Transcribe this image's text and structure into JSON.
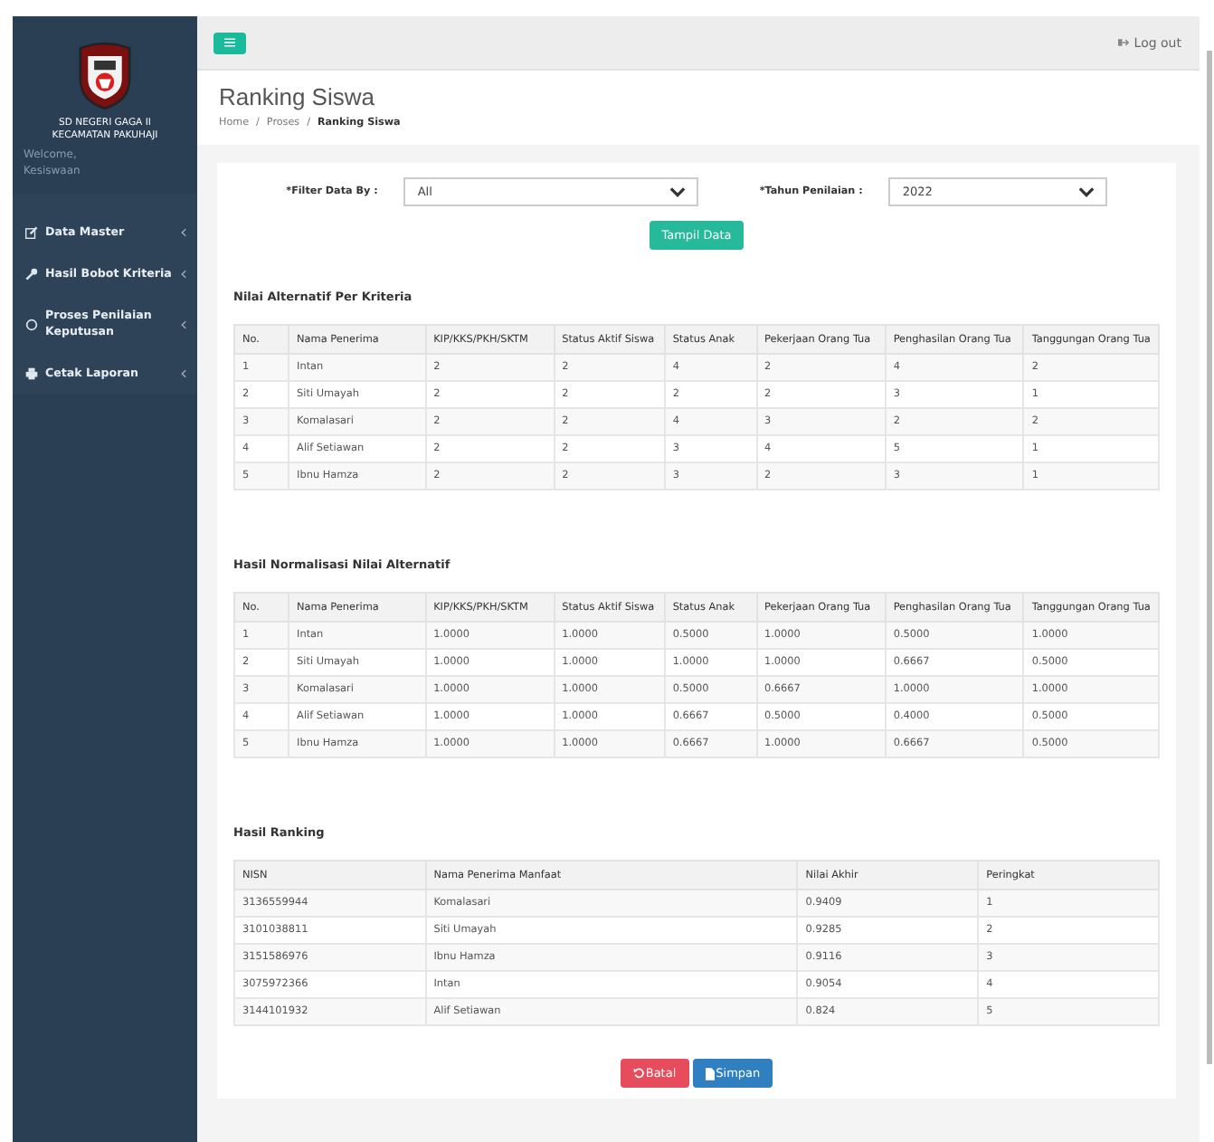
{
  "sidebar": {
    "school": [
      "SD NEGERI GAGA II",
      "KECAMATAN PAKUHAJI"
    ],
    "welcome": "Welcome,",
    "user": "Kesiswaan",
    "menu": [
      {
        "label": "Data Master",
        "kind": "edit"
      },
      {
        "label": "Hasil Bobot Kriteria",
        "kind": "wrench"
      },
      {
        "label": "Proses Penilaian Keputusan",
        "kind": "circle"
      },
      {
        "label": "Cetak Laporan",
        "kind": "print"
      }
    ]
  },
  "topbar": {
    "logout": "Log out"
  },
  "header": {
    "title": "Ranking Siswa",
    "breadcrumb": [
      {
        "label": "Home",
        "kind": "link"
      },
      {
        "label": "/",
        "kind": "separator"
      },
      {
        "label": "Proses",
        "kind": "link"
      },
      {
        "label": "/",
        "kind": "separator"
      },
      {
        "label": "Ranking Siswa",
        "kind": "current"
      }
    ]
  },
  "filters": [
    {
      "label": "*Filter Data By :",
      "value": "All"
    },
    {
      "label": "*Tahun Penilaian :",
      "value": "2022"
    }
  ],
  "show_button": "Tampil Data",
  "tables": [
    {
      "title": "Nilai Alternatif Per Kriteria",
      "columns": [
        "No.",
        "Nama Penerima",
        "KIP/KKS/PKH/SKTM",
        "Status Aktif Siswa",
        "Status Anak",
        "Pekerjaan Orang Tua",
        "Penghasilan Orang Tua",
        "Tanggungan Orang Tua"
      ],
      "rows": [
        [
          "1",
          "Intan",
          "2",
          "2",
          "4",
          "2",
          "4",
          "2"
        ],
        [
          "2",
          "Siti Umayah",
          "2",
          "2",
          "2",
          "2",
          "3",
          "1"
        ],
        [
          "3",
          "Komalasari",
          "2",
          "2",
          "4",
          "3",
          "2",
          "2"
        ],
        [
          "4",
          "Alif Setiawan",
          "2",
          "2",
          "3",
          "4",
          "5",
          "1"
        ],
        [
          "5",
          "Ibnu Hamza",
          "2",
          "2",
          "3",
          "2",
          "3",
          "1"
        ]
      ]
    },
    {
      "title": "Hasil Normalisasi Nilai Alternatif",
      "columns": [
        "No.",
        "Nama Penerima",
        "KIP/KKS/PKH/SKTM",
        "Status Aktif Siswa",
        "Status Anak",
        "Pekerjaan Orang Tua",
        "Penghasilan Orang Tua",
        "Tanggungan Orang Tua"
      ],
      "rows": [
        [
          "1",
          "Intan",
          "1.0000",
          "1.0000",
          "0.5000",
          "1.0000",
          "0.5000",
          "1.0000"
        ],
        [
          "2",
          "Siti Umayah",
          "1.0000",
          "1.0000",
          "1.0000",
          "1.0000",
          "0.6667",
          "0.5000"
        ],
        [
          "3",
          "Komalasari",
          "1.0000",
          "1.0000",
          "0.5000",
          "0.6667",
          "1.0000",
          "1.0000"
        ],
        [
          "4",
          "Alif Setiawan",
          "1.0000",
          "1.0000",
          "0.6667",
          "0.5000",
          "0.4000",
          "0.5000"
        ],
        [
          "5",
          "Ibnu Hamza",
          "1.0000",
          "1.0000",
          "0.6667",
          "1.0000",
          "0.6667",
          "0.5000"
        ]
      ]
    },
    {
      "title": "Hasil Ranking",
      "columns": [
        "NISN",
        "Nama Penerima Manfaat",
        "Nilai Akhir",
        "Peringkat"
      ],
      "rows": [
        [
          "3136559944",
          "Komalasari",
          "0.9409",
          "1"
        ],
        [
          "3101038811",
          "Siti Umayah",
          "0.9285",
          "2"
        ],
        [
          "3151586976",
          "Ibnu Hamza",
          "0.9116",
          "3"
        ],
        [
          "3075972366",
          "Intan",
          "0.9054",
          "4"
        ],
        [
          "3144101932",
          "Alif Setiawan",
          "0.824",
          "5"
        ]
      ]
    }
  ],
  "actions": [
    {
      "label": "Batal",
      "kind": "cancel"
    },
    {
      "label": "Simpan",
      "kind": "save"
    }
  ]
}
